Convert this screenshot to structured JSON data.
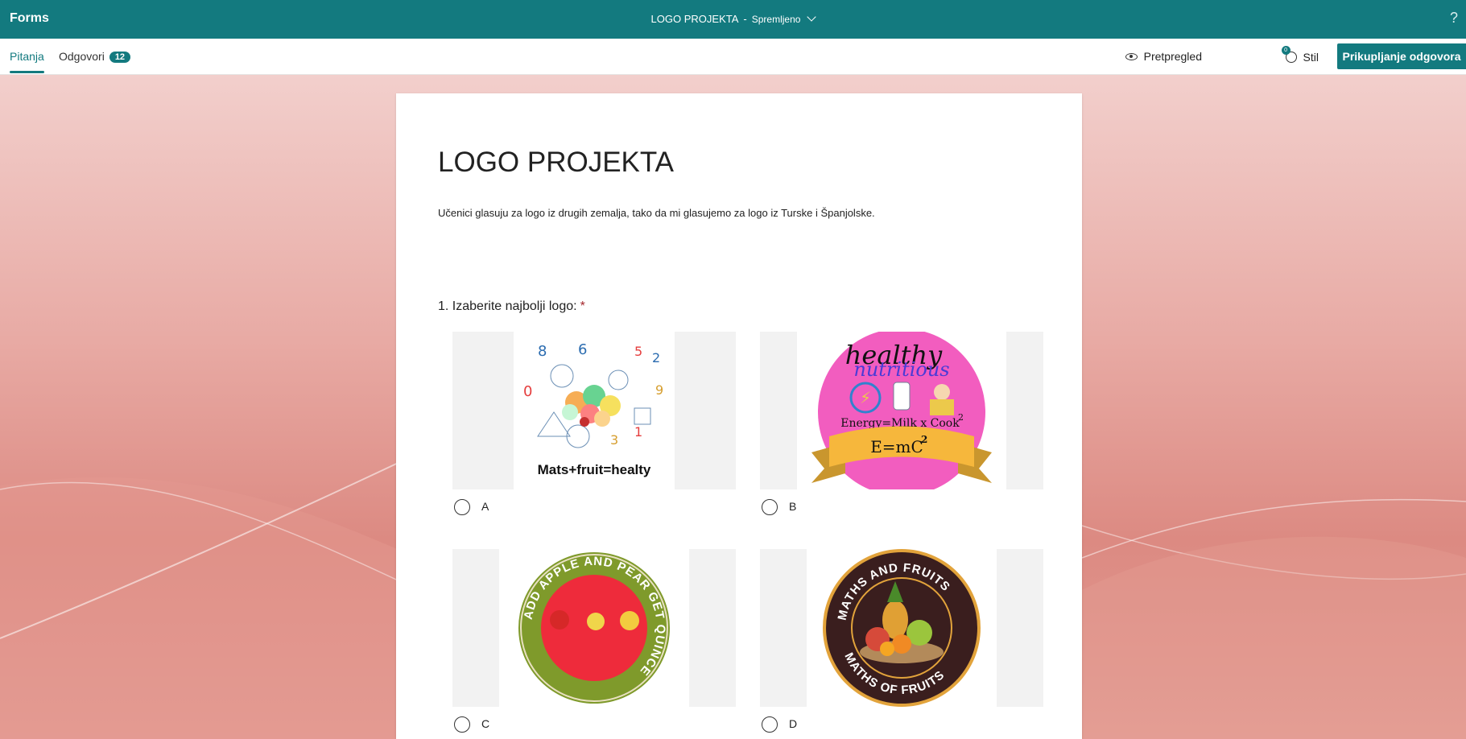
{
  "app": {
    "name": "Forms"
  },
  "document": {
    "title": "LOGO PROJEKTA",
    "separator": "-",
    "status": "Spremljeno"
  },
  "help_icon": "?",
  "tabs": [
    {
      "label": "Pitanja",
      "active": true
    },
    {
      "label": "Odgovori",
      "count": "12"
    }
  ],
  "toolbar": {
    "preview_label": "Pretpregled",
    "style_label": "Stil",
    "style_badge": "0",
    "collect_label": "Prikupljanje odgovora"
  },
  "colors": {
    "accent": "#137a7f",
    "required": "#a4262c"
  },
  "form": {
    "title": "LOGO PROJEKTA",
    "description": "Učenici  glasuju za logo iz drugih zemalja, tako da mi glasujemo za logo iz Turske i Španjolske.",
    "questions": [
      {
        "number": "1.",
        "text": "Izaberite najbolji logo:",
        "required_mark": "*",
        "options": [
          {
            "label": "A",
            "image_text": "Mats+fruit=healty"
          },
          {
            "label": "B",
            "image_text": [
              "healthy",
              "nutritious",
              "Energy=Milk x Cook",
              "2",
              "E=mC",
              "2"
            ]
          },
          {
            "label": "C",
            "image_text": "ADD APPLE AND PEAR GET QUINCE"
          },
          {
            "label": "D",
            "image_text": [
              "MATHS AND FRUITS",
              "MATHS OF FRUITS"
            ]
          }
        ]
      }
    ]
  }
}
